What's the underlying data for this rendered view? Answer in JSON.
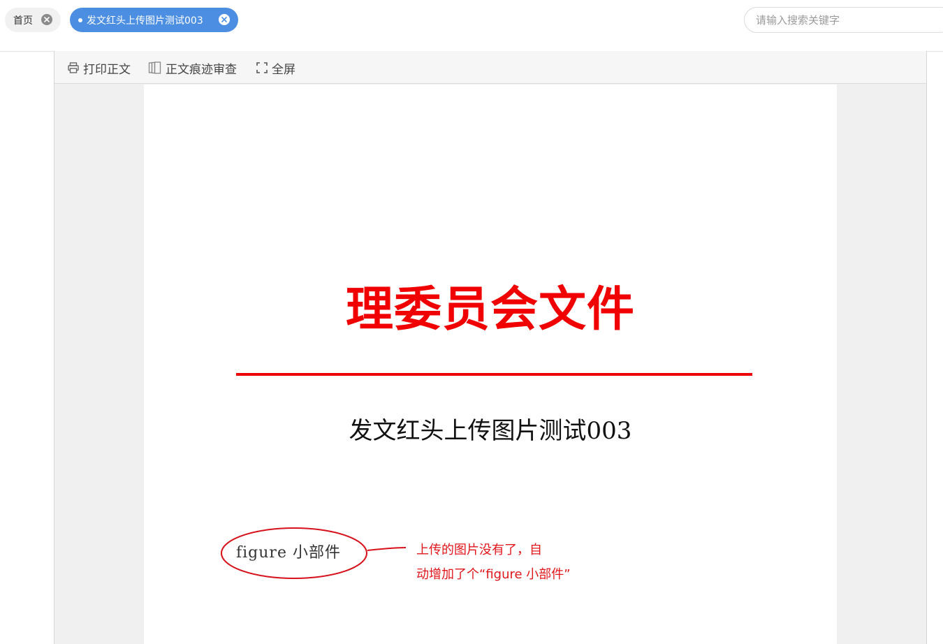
{
  "tabs": {
    "home": {
      "label": "首页"
    },
    "active": {
      "label": "发文红头上传图片测试003"
    }
  },
  "search": {
    "placeholder": "请输入搜索关键字"
  },
  "toolbar": {
    "print_label": "打印正文",
    "revision_label": "正文痕迹审查",
    "fullscreen_label": "全屏"
  },
  "document": {
    "title": "理委员会文件",
    "subtitle": "发文红头上传图片测试003",
    "figure_widget_text": "figure 小部件"
  },
  "annotation": {
    "line1": "上传的图片没有了，自",
    "line2": "动增加了个“figure 小部件”"
  },
  "colors": {
    "accent": "#4c8fe2",
    "doc_red": "#ee0000",
    "annotation_red": "#e0161b"
  }
}
